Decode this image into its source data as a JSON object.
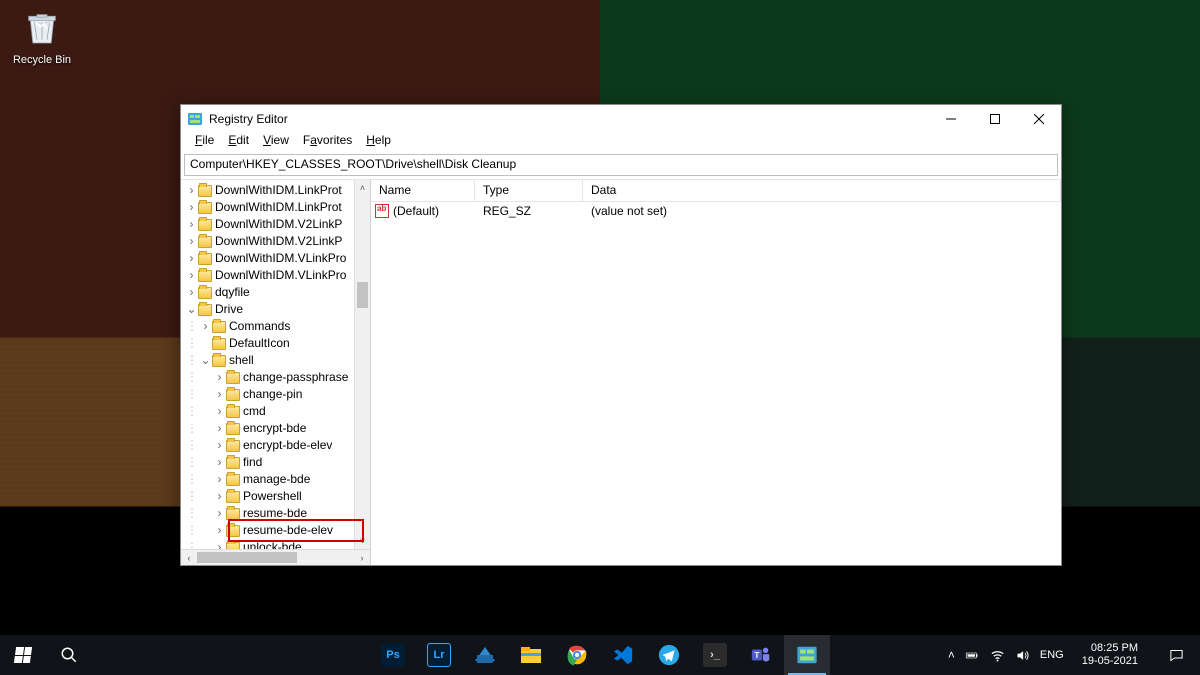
{
  "desktop": {
    "recycle_label": "Recycle Bin"
  },
  "window": {
    "title": "Registry Editor",
    "menu": {
      "file": "File",
      "edit": "Edit",
      "view": "View",
      "favorites": "Favorites",
      "help": "Help"
    },
    "address": "Computer\\HKEY_CLASSES_ROOT\\Drive\\shell\\Disk Cleanup",
    "columns": {
      "name": "Name",
      "type": "Type",
      "data": "Data"
    },
    "values": [
      {
        "name": "(Default)",
        "type": "REG_SZ",
        "data": "(value not set)"
      }
    ],
    "tree": {
      "top_items": [
        "DownlWithIDM.LinkProt",
        "DownlWithIDM.LinkProt",
        "DownlWithIDM.V2LinkP",
        "DownlWithIDM.V2LinkP",
        "DownlWithIDM.VLinkPro",
        "DownlWithIDM.VLinkPro",
        "dqyfile"
      ],
      "drive": "Drive",
      "drive_children_a": [
        "Commands",
        "DefaultIcon"
      ],
      "shell": "shell",
      "shell_children": [
        "change-passphrase",
        "change-pin",
        "cmd",
        "encrypt-bde",
        "encrypt-bde-elev",
        "find",
        "manage-bde",
        "Powershell",
        "resume-bde",
        "resume-bde-elev",
        "unlock-bde"
      ],
      "editing_value": "Disk Cleanup"
    }
  },
  "taskbar": {
    "lang": "ENG",
    "time": "08:25 PM",
    "date": "19-05-2021"
  }
}
